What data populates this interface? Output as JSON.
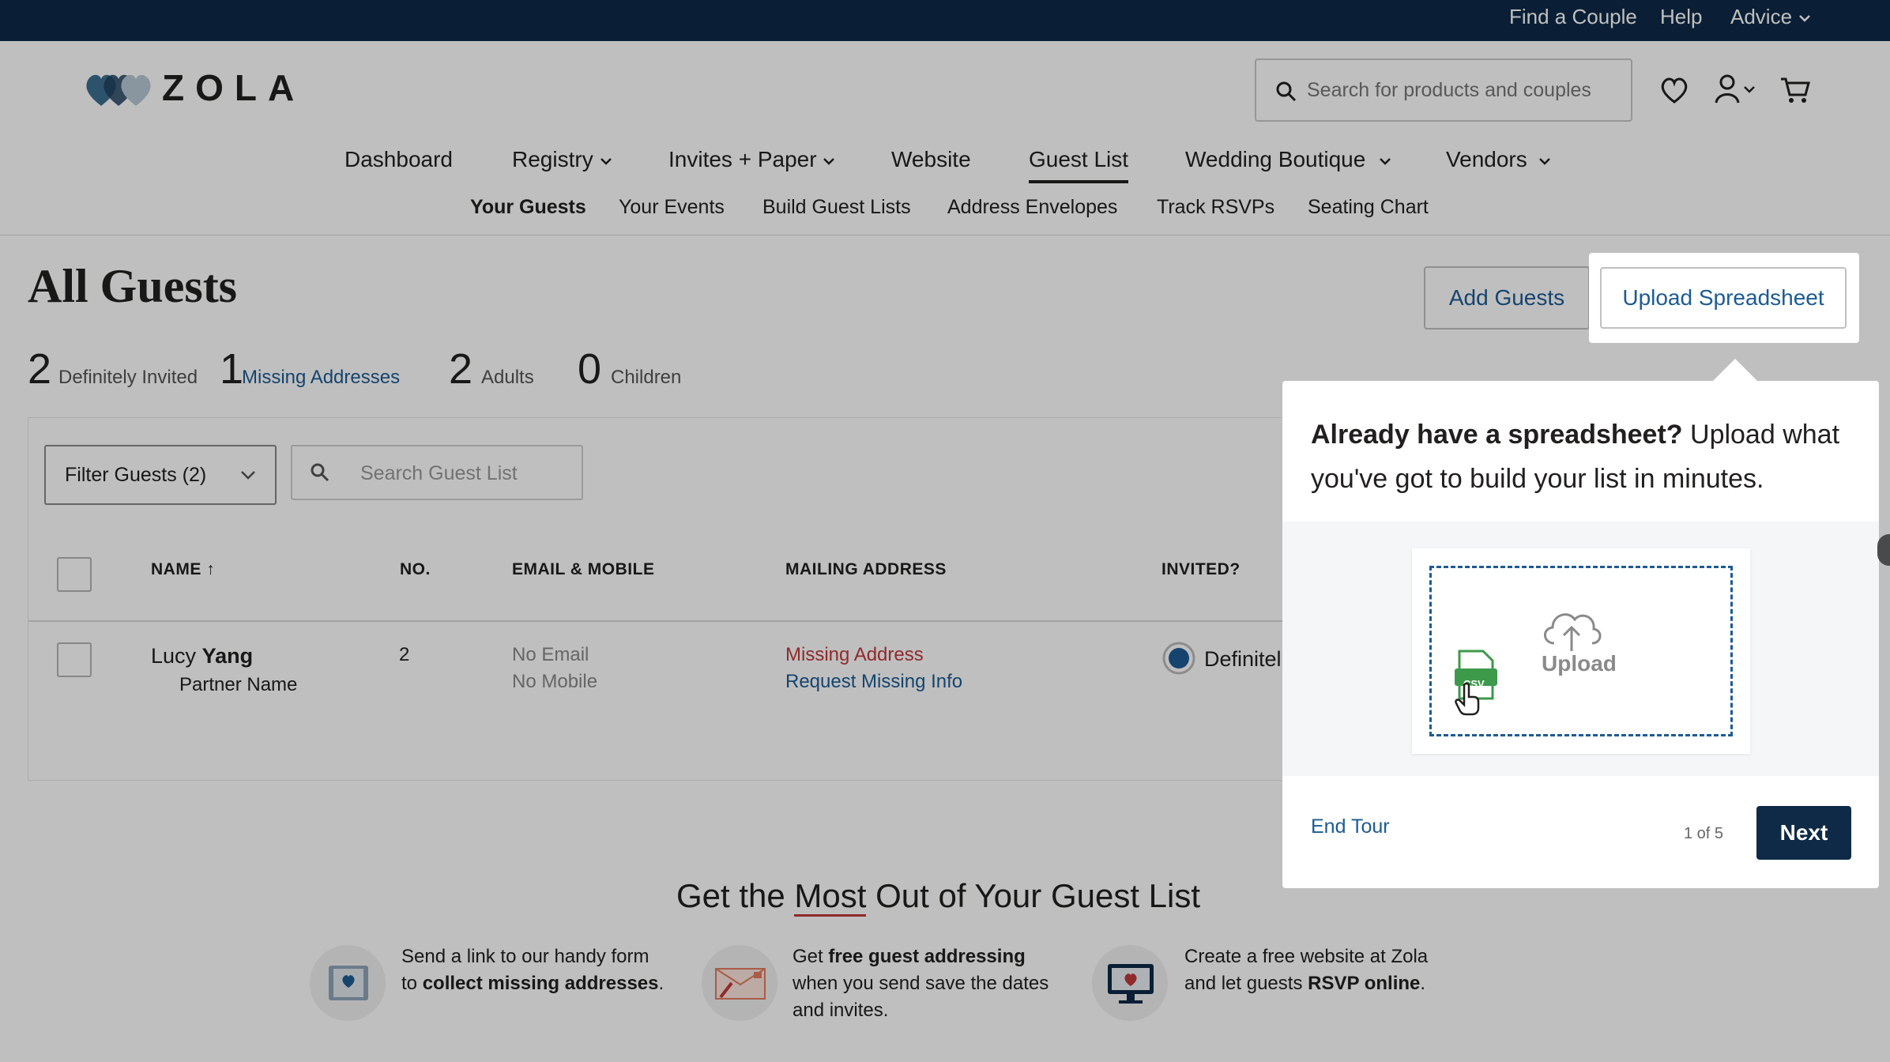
{
  "utility_nav": {
    "find_couple": "Find a Couple",
    "help": "Help",
    "advice": "Advice"
  },
  "brand": {
    "logo_text": "ZOLA"
  },
  "search": {
    "placeholder": "Search for products and couples"
  },
  "main_nav": [
    {
      "label": "Dashboard"
    },
    {
      "label": "Registry"
    },
    {
      "label": "Invites + Paper"
    },
    {
      "label": "Website"
    },
    {
      "label": "Guest List"
    },
    {
      "label": "Wedding Boutique"
    },
    {
      "label": "Vendors"
    }
  ],
  "sub_nav": [
    {
      "label": "Your Guests"
    },
    {
      "label": "Your Events"
    },
    {
      "label": "Build Guest Lists"
    },
    {
      "label": "Address Envelopes"
    },
    {
      "label": "Track RSVPs"
    },
    {
      "label": "Seating Chart"
    }
  ],
  "page": {
    "title": "All Guests",
    "add_guests": "Add Guests",
    "upload_spreadsheet": "Upload Spreadsheet"
  },
  "stats": [
    {
      "num": "2",
      "label": "Definitely Invited"
    },
    {
      "num": "1",
      "label": "Missing Addresses"
    },
    {
      "num": "2",
      "label": "Adults"
    },
    {
      "num": "0",
      "label": "Children"
    }
  ],
  "toolbar": {
    "filter": "Filter Guests (2)",
    "search_placeholder": "Search Guest List"
  },
  "table": {
    "headers": {
      "name": "NAME",
      "sort_arrow": "↑",
      "no": "NO.",
      "email": "EMAIL & MOBILE",
      "address": "MAILING ADDRESS",
      "invited": "INVITED?"
    },
    "row": {
      "first_name": "Lucy",
      "last_name": "Yang",
      "partner": "Partner Name",
      "count": "2",
      "email": "No Email",
      "mobile": "No Mobile",
      "address_status": "Missing Address",
      "request": "Request Missing Info",
      "invited": "Definitel"
    }
  },
  "promo": {
    "title_pre": "Get the ",
    "title_emph": "Most",
    "title_post": " Out of Your Guest List",
    "items": [
      {
        "t1": "Send a link to our handy form",
        "t2": "to ",
        "bold": "collect missing addresses",
        "t3": "."
      },
      {
        "t1": "Get ",
        "bold1": "free guest addressing",
        "t2": "when you send save the dates",
        "t3": "and invites."
      },
      {
        "t1": "Create a free website at Zola",
        "t2": "and let guests ",
        "bold": "RSVP online",
        "t3": "."
      }
    ]
  },
  "tour": {
    "head_bold": "Already have a spreadsheet?",
    "head_rest": " Upload what you've got to build your list in minutes.",
    "file_badge": "CSV",
    "upload_label": "Upload",
    "end_tour": "End Tour",
    "pager": "1 of 5",
    "next": "Next"
  },
  "colors": {
    "navy": "#0e2a47",
    "link_blue": "#1c5b94",
    "missing_red": "#c0393b"
  }
}
